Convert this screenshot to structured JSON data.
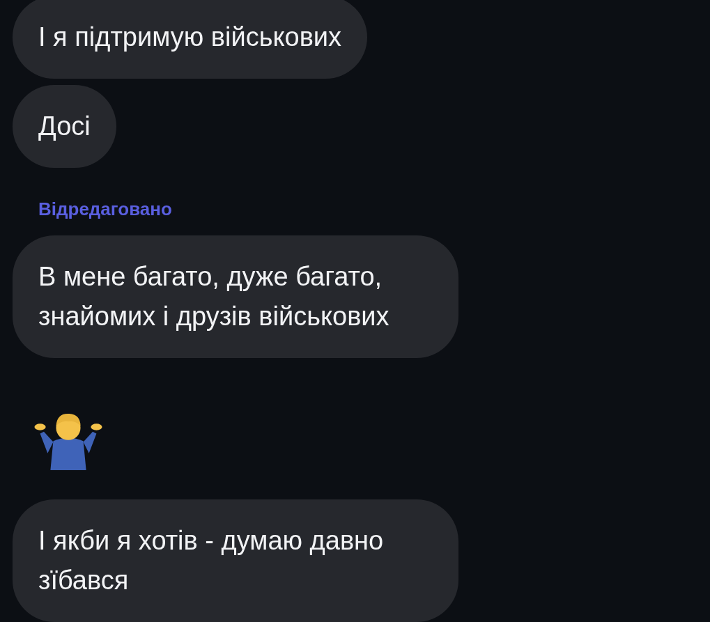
{
  "messages": [
    {
      "kind": "text",
      "text": "І я підтримую військових"
    },
    {
      "kind": "text",
      "text": "Досі"
    },
    {
      "kind": "edited",
      "text": "Відредаговано"
    },
    {
      "kind": "text",
      "text": "В мене багато, дуже багато, знайомих і друзів військових"
    },
    {
      "kind": "emoji"
    },
    {
      "kind": "text",
      "text": "І якби я хотів - думаю давно зїбався"
    }
  ]
}
